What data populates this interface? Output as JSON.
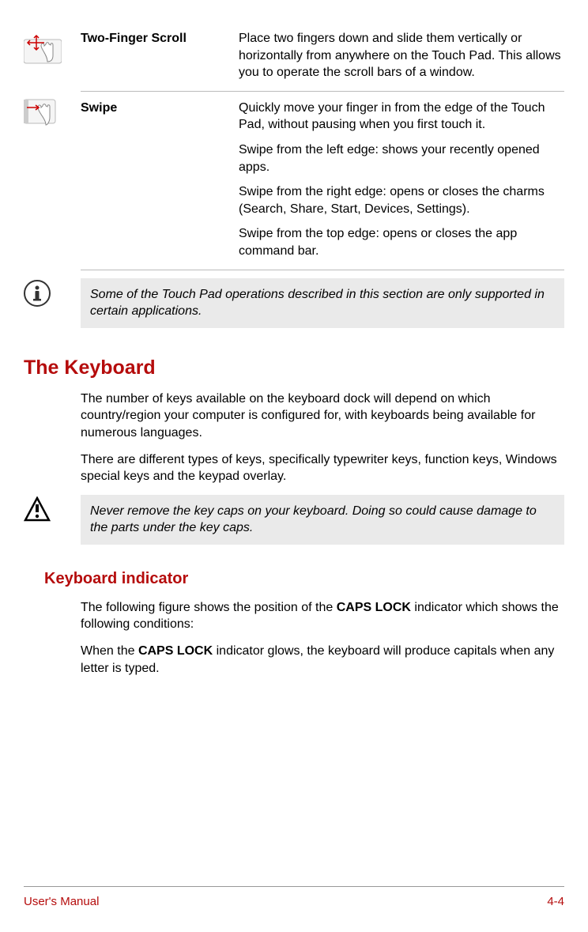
{
  "gestures": [
    {
      "name": "Two-Finger Scroll",
      "paragraphs": [
        "Place two fingers down and slide them vertically or horizontally from anywhere on the Touch Pad. This allows you to operate the scroll bars of a window."
      ]
    },
    {
      "name": "Swipe",
      "paragraphs": [
        "Quickly move your finger in from the edge of the Touch Pad, without pausing when you first touch it.",
        "Swipe from the left edge: shows your recently opened apps.",
        "Swipe from the right edge: opens or closes the charms (Search, Share, Start, Devices, Settings).",
        "Swipe from the top edge: opens or closes the app command bar."
      ]
    }
  ],
  "info_callout": "Some of the Touch Pad operations described in this section are only supported in certain applications.",
  "section_heading": "The Keyboard",
  "keyboard_paragraphs": [
    "The number of keys available on the keyboard dock will depend on which country/region your computer is configured for, with keyboards being available for numerous languages.",
    "There are different types of keys, specifically typewriter keys, function keys, Windows special keys and the keypad overlay."
  ],
  "warning_callout": "Never remove the key caps on your keyboard. Doing so could cause damage to the parts under the key caps.",
  "sub_heading": "Keyboard indicator",
  "indicator_p1_pre": "The following figure shows the position of the ",
  "indicator_bold1": "CAPS LOCK",
  "indicator_p1_post": " indicator which shows the following conditions:",
  "indicator_p2_pre": "When the ",
  "indicator_bold2": "CAPS LOCK",
  "indicator_p2_post": " indicator glows, the keyboard will produce capitals when any letter is typed.",
  "footer_left": "User's Manual",
  "footer_right": "4-4"
}
